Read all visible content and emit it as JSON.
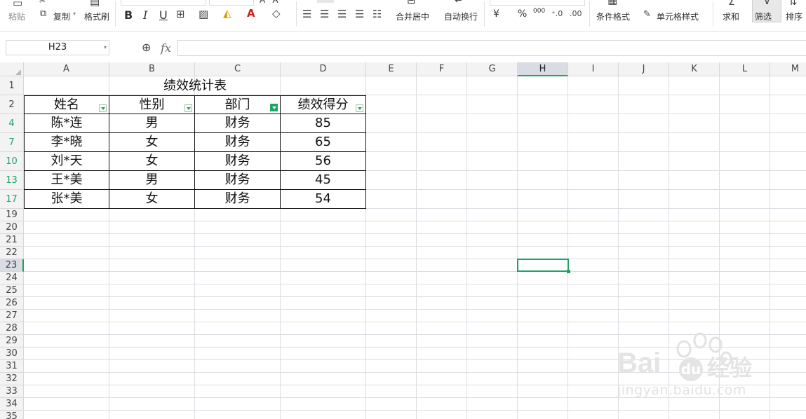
{
  "ribbon": {
    "paste": "粘贴",
    "copy": "复制",
    "format_painter": "格式刷",
    "bold": "B",
    "italic": "I",
    "underline": "U",
    "merge_center": "合并居中",
    "wrap_text": "自动换行",
    "currency": "¥",
    "percent": "%",
    "thousands": "000",
    "cond_format": "条件格式",
    "cell_style": "单元格样式",
    "sum": "求和",
    "filter": "筛选",
    "sort": "排序"
  },
  "formula_bar": {
    "name_box": "H23",
    "fx": "fx",
    "formula": ""
  },
  "columns": [
    "A",
    "B",
    "C",
    "D",
    "E",
    "F",
    "G",
    "H",
    "I",
    "J",
    "K",
    "L",
    "M"
  ],
  "selected_column": "H",
  "rows": [
    "1",
    "2",
    "4",
    "7",
    "10",
    "13",
    "17",
    "19",
    "20",
    "21",
    "22",
    "23",
    "24",
    "25",
    "26",
    "27",
    "28",
    "29",
    "30",
    "31",
    "32",
    "33",
    "34",
    "35"
  ],
  "filtered_rows": [
    "4",
    "7",
    "10",
    "13",
    "17"
  ],
  "selected_row": "23",
  "table": {
    "title": "绩效统计表",
    "headers": [
      "姓名",
      "性别",
      "部门",
      "绩效得分"
    ],
    "rows": [
      [
        "陈*连",
        "男",
        "财务",
        "85"
      ],
      [
        "李*晓",
        "女",
        "财务",
        "65"
      ],
      [
        "刘*天",
        "女",
        "财务",
        "56"
      ],
      [
        "王*美",
        "男",
        "财务",
        "45"
      ],
      [
        "张*美",
        "女",
        "财务",
        "54"
      ]
    ]
  },
  "watermark": {
    "brand": "Bai",
    "brand2": "du",
    "product": "经验",
    "url": "jingyan.baidu.com"
  }
}
